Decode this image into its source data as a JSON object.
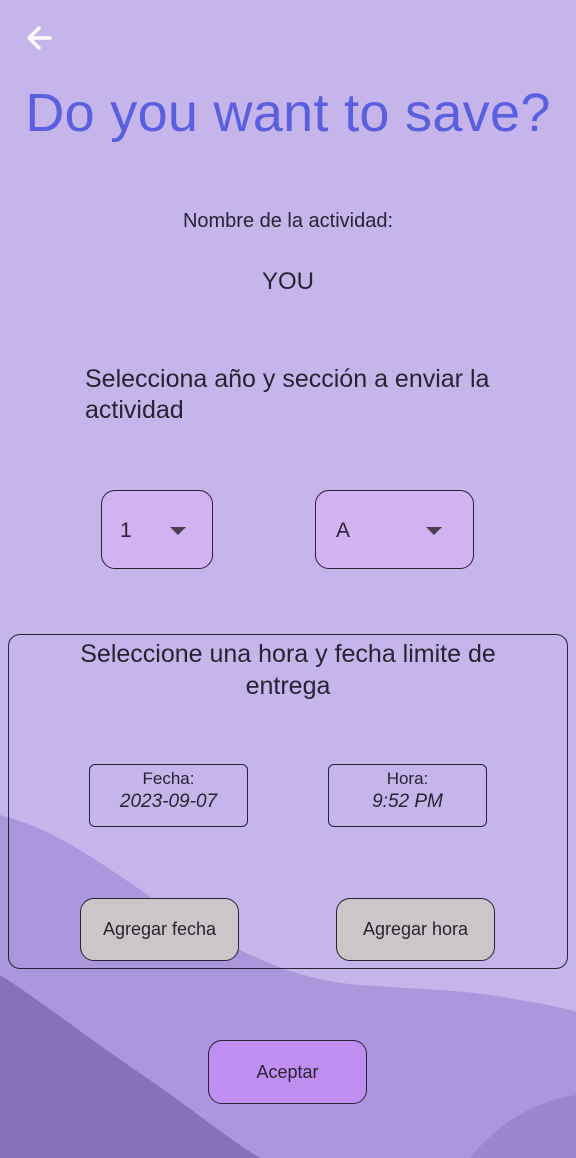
{
  "colors": {
    "background": "#c5b5ea",
    "title": "#5a5fe0",
    "dropdown_fill": "#d3b2f2",
    "secondary_button": "#ccc6c8",
    "primary_button": "#bf8ef0",
    "wave_light": "#ab98dc",
    "wave_dark": "#8871b6"
  },
  "header": {
    "back_icon": "arrow-left-icon",
    "title": "Do you want to save?"
  },
  "activity": {
    "label": "Nombre de la actividad:",
    "name": "YOU"
  },
  "selection": {
    "instruction": "Selecciona año y sección a enviar la actividad",
    "year_value": "1",
    "section_value": "A",
    "caret_icon": "caret-down-icon"
  },
  "deadline": {
    "title": "Seleccione una hora y fecha limite de entrega",
    "date_label": "Fecha:",
    "date_value": "2023-09-07",
    "time_label": "Hora:",
    "time_value": "9:52 PM",
    "add_date_button": "Agregar fecha",
    "add_time_button": "Agregar hora"
  },
  "footer": {
    "accept_button": "Aceptar"
  }
}
